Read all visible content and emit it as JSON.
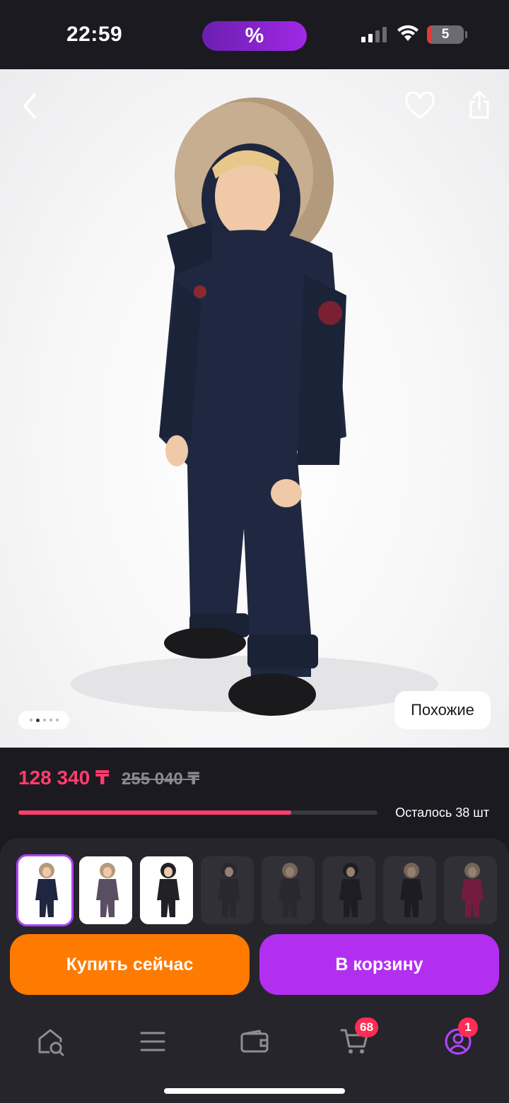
{
  "status": {
    "time": "22:59",
    "promo_symbol": "%",
    "battery_level": "5"
  },
  "hero": {
    "icons": [
      "back-arrow-icon",
      "heart-icon",
      "share-icon"
    ],
    "similar_label": "Похожие",
    "slide_count": 5,
    "slide_active": 2
  },
  "pricing": {
    "price": "128 340 ₸",
    "old_price": "255 040 ₸",
    "stock_text": "Осталось 38 шт",
    "stock_progress": 0.76,
    "accent_color": "#ff3d6e"
  },
  "variants": [
    {
      "selected": true,
      "color": "#1e2640"
    },
    {
      "selected": false,
      "color": "#5a4e62"
    },
    {
      "selected": false,
      "color": "#222226"
    },
    {
      "selected": false,
      "color": "#2c2c34"
    },
    {
      "selected": false,
      "color": "#2c2c34"
    },
    {
      "selected": false,
      "color": "#18181e"
    },
    {
      "selected": false,
      "color": "#16161c"
    },
    {
      "selected": false,
      "color": "#b01850"
    }
  ],
  "actions": {
    "buy_now": "Купить сейчас",
    "add_to_cart": "В корзину",
    "buy_color": "#ff7a00",
    "cart_color": "#b22ff0"
  },
  "bottom_nav": {
    "items": [
      {
        "icon": "home-search-icon"
      },
      {
        "icon": "catalog-menu-icon"
      },
      {
        "icon": "wallet-icon"
      },
      {
        "icon": "cart-icon",
        "badge": "68"
      },
      {
        "icon": "profile-icon",
        "badge": "1"
      }
    ]
  }
}
